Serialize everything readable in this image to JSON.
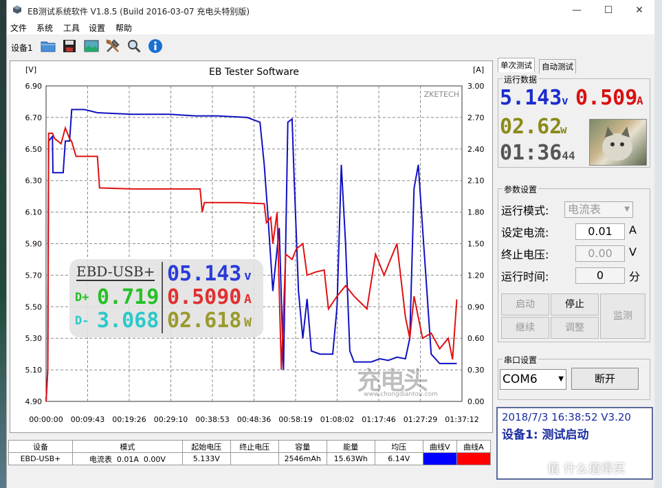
{
  "window": {
    "title": "EB测试系统软件 V1.8.5 (Build 2016-03-07 充电头特别版)",
    "minimize": "—",
    "maximize": "☐",
    "close": "✕"
  },
  "menu": [
    "文件",
    "系统",
    "工具",
    "设置",
    "帮助"
  ],
  "toolbar": {
    "device": "设备1"
  },
  "chart": {
    "title": "EB Tester Software",
    "watermark_top": "ZKETECH",
    "watermark_url": "www.chongdiantou.com"
  },
  "chart_data": {
    "type": "line",
    "title": "EB Tester Software",
    "ylabel_left": "[V]",
    "ylabel_right": "[A]",
    "ylim_left": [
      4.9,
      6.9
    ],
    "ylim_right": [
      0.0,
      3.0
    ],
    "yticks_left": [
      "6.90",
      "6.70",
      "6.50",
      "6.30",
      "6.10",
      "5.90",
      "5.70",
      "5.50",
      "5.30",
      "5.10",
      "4.90"
    ],
    "yticks_right": [
      "3.00",
      "2.70",
      "2.40",
      "2.10",
      "1.80",
      "1.50",
      "1.20",
      "0.90",
      "0.60",
      "0.30",
      "0.00"
    ],
    "xticks": [
      "00:00:00",
      "00:09:43",
      "00:19:26",
      "00:29:10",
      "00:38:53",
      "00:48:36",
      "00:58:19",
      "01:08:02",
      "01:17:46",
      "01:27:29",
      "01:37:12"
    ],
    "xlim_minutes": [
      0,
      97.2
    ],
    "grid": true,
    "series": [
      {
        "axis": "left",
        "color": "#1010c0",
        "points": [
          [
            0,
            4.9
          ],
          [
            0.4,
            5.1
          ],
          [
            0.6,
            6.55
          ],
          [
            1.5,
            6.58
          ],
          [
            1.6,
            6.35
          ],
          [
            4,
            6.35
          ],
          [
            4.5,
            6.55
          ],
          [
            5.5,
            6.55
          ],
          [
            6,
            6.75
          ],
          [
            9,
            6.75
          ],
          [
            12,
            6.73
          ],
          [
            20,
            6.72
          ],
          [
            29,
            6.72
          ],
          [
            35,
            6.71
          ],
          [
            40,
            6.71
          ],
          [
            47,
            6.7
          ],
          [
            50,
            6.67
          ],
          [
            51,
            6.4
          ],
          [
            51.8,
            6.1
          ],
          [
            53,
            5.6
          ],
          [
            54.5,
            6.0
          ],
          [
            55.5,
            5.1
          ],
          [
            56.5,
            6.67
          ],
          [
            57.5,
            6.69
          ],
          [
            58,
            6.3
          ],
          [
            59,
            5.6
          ],
          [
            60,
            5.3
          ],
          [
            61,
            5.55
          ],
          [
            62,
            5.22
          ],
          [
            64,
            5.2
          ],
          [
            67,
            5.2
          ],
          [
            68,
            5.5
          ],
          [
            69,
            6.4
          ],
          [
            70,
            5.9
          ],
          [
            71,
            5.22
          ],
          [
            72,
            5.15
          ],
          [
            76,
            5.15
          ],
          [
            78,
            5.17
          ],
          [
            80,
            5.16
          ],
          [
            82,
            5.18
          ],
          [
            84,
            5.17
          ],
          [
            85,
            5.3
          ],
          [
            86,
            6.25
          ],
          [
            87,
            6.4
          ],
          [
            88,
            6.0
          ],
          [
            89,
            5.6
          ],
          [
            90,
            5.2
          ],
          [
            92,
            5.14
          ],
          [
            96,
            5.14
          ]
        ]
      },
      {
        "axis": "right",
        "color": "#e01010",
        "points": [
          [
            0,
            0.0
          ],
          [
            0.4,
            0.3
          ],
          [
            0.6,
            2.55
          ],
          [
            1.5,
            2.55
          ],
          [
            2,
            2.5
          ],
          [
            3.5,
            2.45
          ],
          [
            4.5,
            2.6
          ],
          [
            5.5,
            2.5
          ],
          [
            6,
            2.47
          ],
          [
            7,
            2.33
          ],
          [
            12,
            2.33
          ],
          [
            12.5,
            2.03
          ],
          [
            20,
            2.02
          ],
          [
            29,
            2.02
          ],
          [
            36,
            2.02
          ],
          [
            36.5,
            1.8
          ],
          [
            37,
            1.89
          ],
          [
            45,
            1.89
          ],
          [
            51,
            1.88
          ],
          [
            51.5,
            1.7
          ],
          [
            52.5,
            1.75
          ],
          [
            53,
            1.5
          ],
          [
            54,
            1.8
          ],
          [
            55,
            0.3
          ],
          [
            56,
            1.4
          ],
          [
            57.5,
            1.35
          ],
          [
            58.5,
            1.45
          ],
          [
            60,
            1.5
          ],
          [
            61,
            1.2
          ],
          [
            63,
            1.23
          ],
          [
            65,
            1.25
          ],
          [
            66,
            0.88
          ],
          [
            68,
            1.0
          ],
          [
            70,
            1.1
          ],
          [
            72,
            1.0
          ],
          [
            75,
            0.88
          ],
          [
            77,
            1.4
          ],
          [
            79,
            1.2
          ],
          [
            82,
            1.5
          ],
          [
            84,
            0.8
          ],
          [
            85,
            0.6
          ],
          [
            86,
            1.0
          ],
          [
            88,
            0.6
          ],
          [
            90,
            0.65
          ],
          [
            92,
            0.5
          ],
          [
            94,
            0.6
          ],
          [
            95,
            0.4
          ],
          [
            96,
            0.97
          ]
        ]
      }
    ]
  },
  "overlay": {
    "device": "EBD-USB+",
    "dplus_label": "D+",
    "dplus_value": "0.719",
    "dminus_label": "D-",
    "dminus_value": "3.068",
    "voltage": "05.143",
    "voltage_unit": "v",
    "current": "0.5090",
    "current_unit": "A",
    "power": "02.618",
    "power_unit": "W"
  },
  "table": {
    "headers": [
      "设备",
      "模式",
      "起始电压",
      "终止电压",
      "容量",
      "能量",
      "均压",
      "曲线V",
      "曲线A"
    ],
    "row": [
      "EBD-USB+",
      "电流表  0.01A  0.00V",
      "5.133V",
      "",
      "2546mAh",
      "15.63Wh",
      "6.14V",
      "",
      ""
    ],
    "curve_v_color": "#0000ff",
    "curve_a_color": "#ff0000"
  },
  "right_panel": {
    "tabs": [
      "单次测试",
      "自动测试"
    ],
    "run_data_title": "运行数据",
    "voltage": "5.143",
    "voltage_unit": "v",
    "current": "0.509",
    "current_unit": "A",
    "power": "02.62",
    "power_unit": "w",
    "time_h": "01",
    "time_m": "36",
    "time_s": "44",
    "params_title": "参数设置",
    "mode_label": "运行模式:",
    "mode_value": "电流表",
    "set_current_label": "设定电流:",
    "set_current_value": "0.01",
    "set_current_unit": "A",
    "stop_voltage_label": "终止电压:",
    "stop_voltage_value": "0.00",
    "stop_voltage_unit": "V",
    "run_time_label": "运行时间:",
    "run_time_value": "0",
    "run_time_unit": "分",
    "btn_start": "启动",
    "btn_stop": "停止",
    "btn_continue": "继续",
    "btn_adjust": "调整",
    "btn_monitor": "监测",
    "serial_title": "串口设置",
    "com_port": "COM6",
    "btn_disconnect": "断开",
    "status_line1": "2018/7/3 16:38:52  V3.20",
    "status_line2": "设备1: 测试启动"
  },
  "watermark_brand": "值 什么值得买"
}
